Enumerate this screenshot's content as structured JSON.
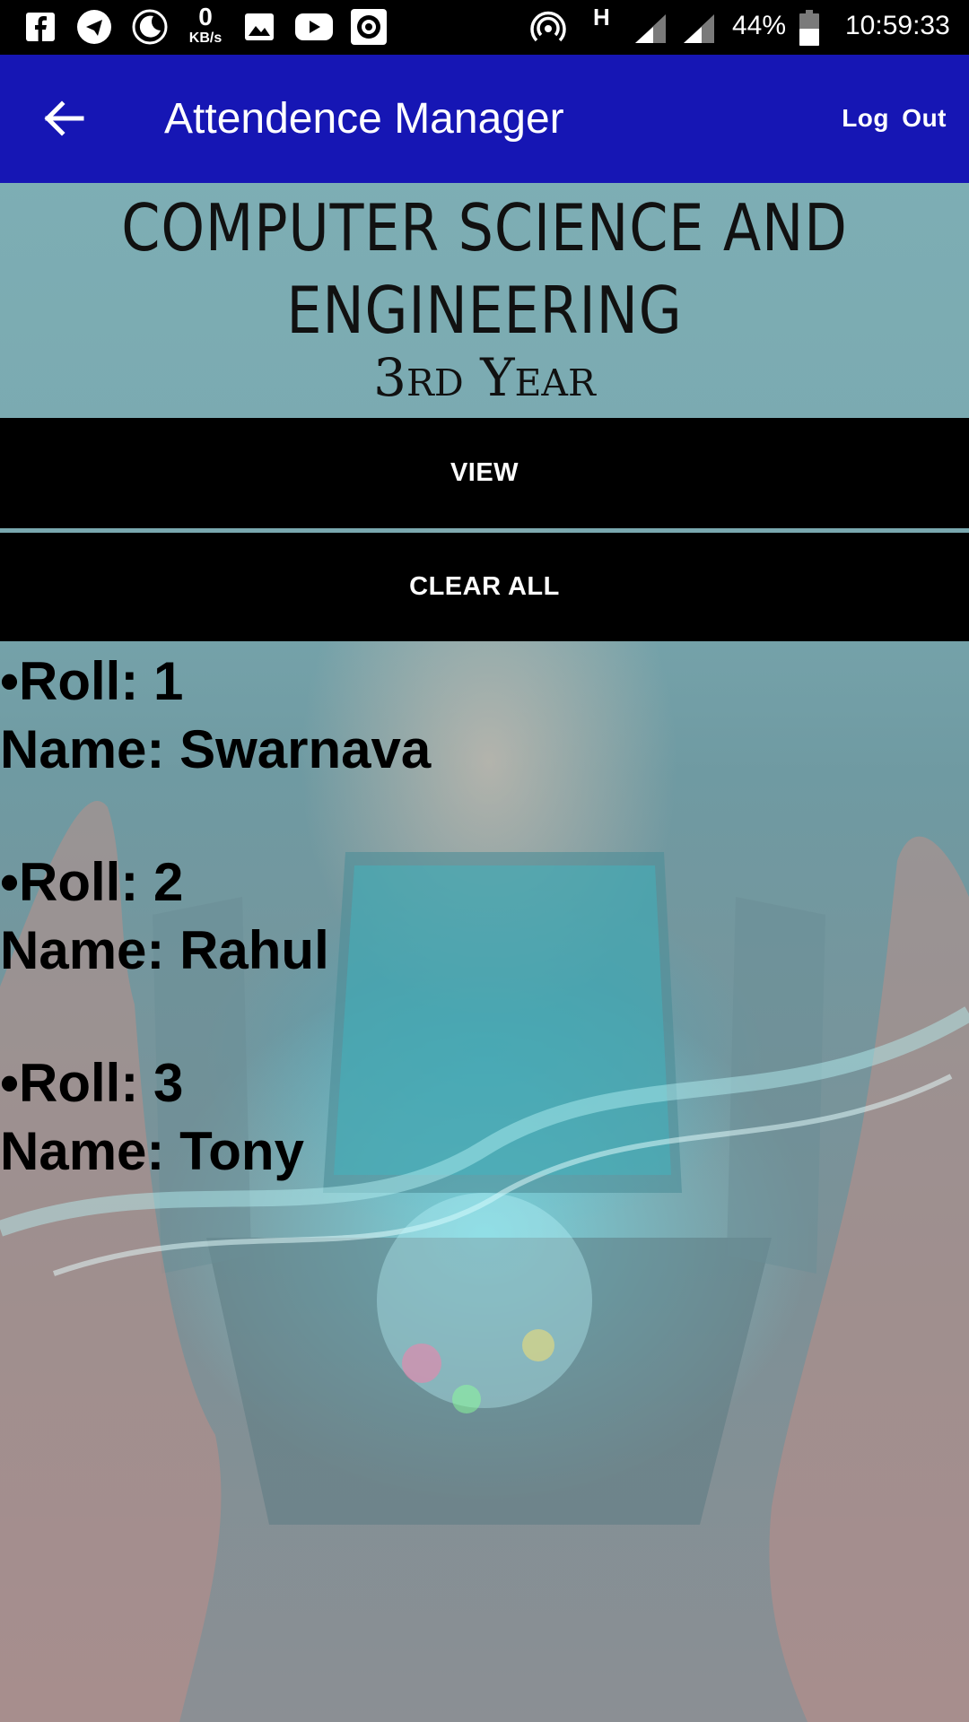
{
  "status_bar": {
    "network_speed_value": "0",
    "network_speed_unit": "KB/s",
    "network_type": "H",
    "battery": "44%",
    "time": "10:59:33",
    "icons": [
      "facebook-icon",
      "telegram-icon",
      "night-mode-icon",
      "gallery-icon",
      "youtube-icon",
      "music-icon",
      "hotspot-icon",
      "signal-icon",
      "signal-icon",
      "battery-icon"
    ]
  },
  "app_bar": {
    "title": "Attendence Manager",
    "logout_label": "Log  Out",
    "color": "#1616b4"
  },
  "header": {
    "department": "COMPUTER SCIENCE AND ENGINEERING",
    "department_line1": "COMPUTER SCIENCE AND",
    "department_line2": "ENGINEERING",
    "year": "3rd Year"
  },
  "buttons": {
    "view_label": "VIEW",
    "clear_all_label": "CLEAR ALL"
  },
  "students": [
    {
      "roll_text": "•Roll: 1",
      "name_text": "Name: Swarnava"
    },
    {
      "roll_text": "•Roll: 2",
      "name_text": "Name: Rahul"
    },
    {
      "roll_text": "•Roll: 3",
      "name_text": "Name: Tony"
    }
  ]
}
